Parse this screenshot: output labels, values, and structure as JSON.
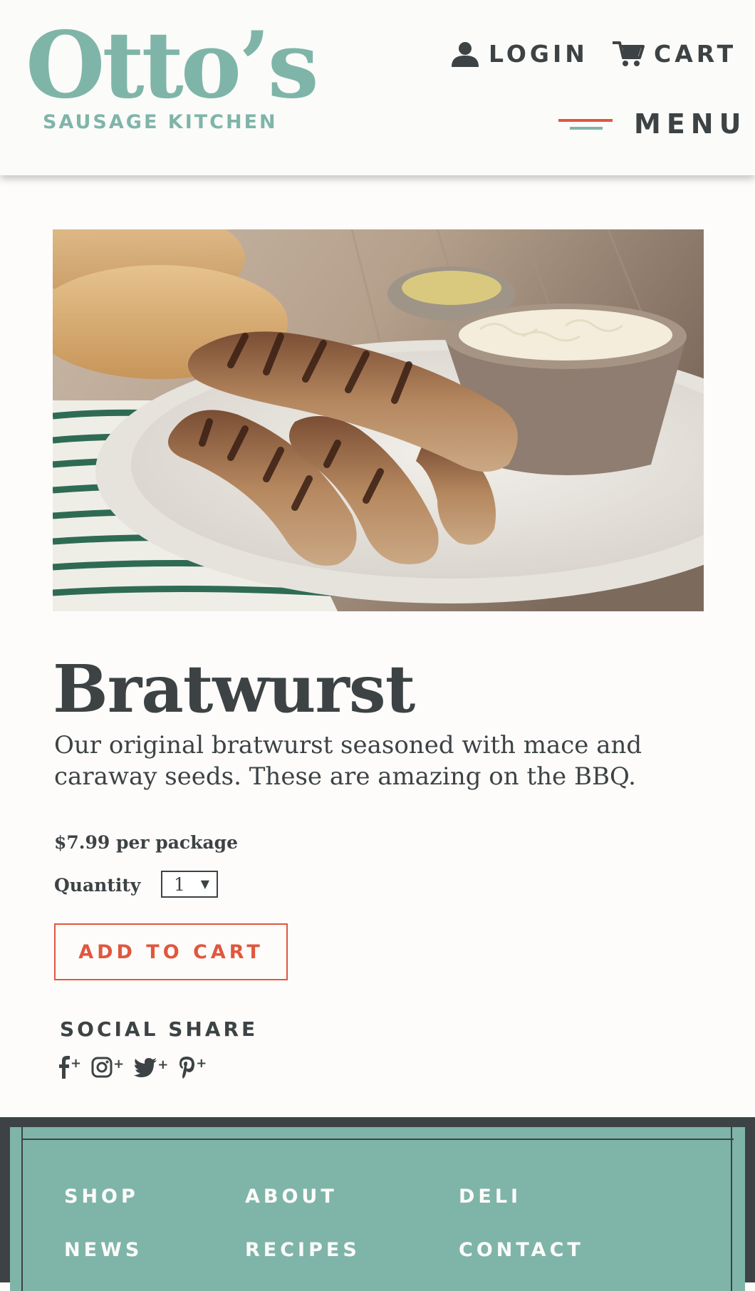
{
  "brand": {
    "name": "Otto’s",
    "tagline": "SAUSAGE KITCHEN",
    "color": "#7fb5a9"
  },
  "header": {
    "login_label": "LOGIN",
    "cart_label": "CART",
    "menu_label": "MENU",
    "icons": [
      "user-icon",
      "cart-icon",
      "hamburger-icon"
    ]
  },
  "product": {
    "image_alt": "Grilled bratwurst sausages on a white plate with sauerkraut",
    "title": "Bratwurst",
    "description": "Our original bratwurst seasoned with mace and caraway seeds. These are amazing on the BBQ.",
    "price": "$7.99 per package",
    "quantity_label": "Quantity",
    "quantity_value": "1",
    "add_to_cart_label": "ADD TO CART"
  },
  "social": {
    "title": "SOCIAL SHARE",
    "plus": "+",
    "icons": [
      "facebook-icon",
      "instagram-icon",
      "twitter-icon",
      "pinterest-icon"
    ]
  },
  "footer": {
    "links": [
      "SHOP",
      "ABOUT",
      "DELI",
      "NEWS",
      "RECIPES",
      "CONTACT"
    ]
  },
  "colors": {
    "accent": "#e0573e",
    "teal": "#7fb5a9",
    "text": "#3d4345",
    "background": "#fdfcfa"
  }
}
